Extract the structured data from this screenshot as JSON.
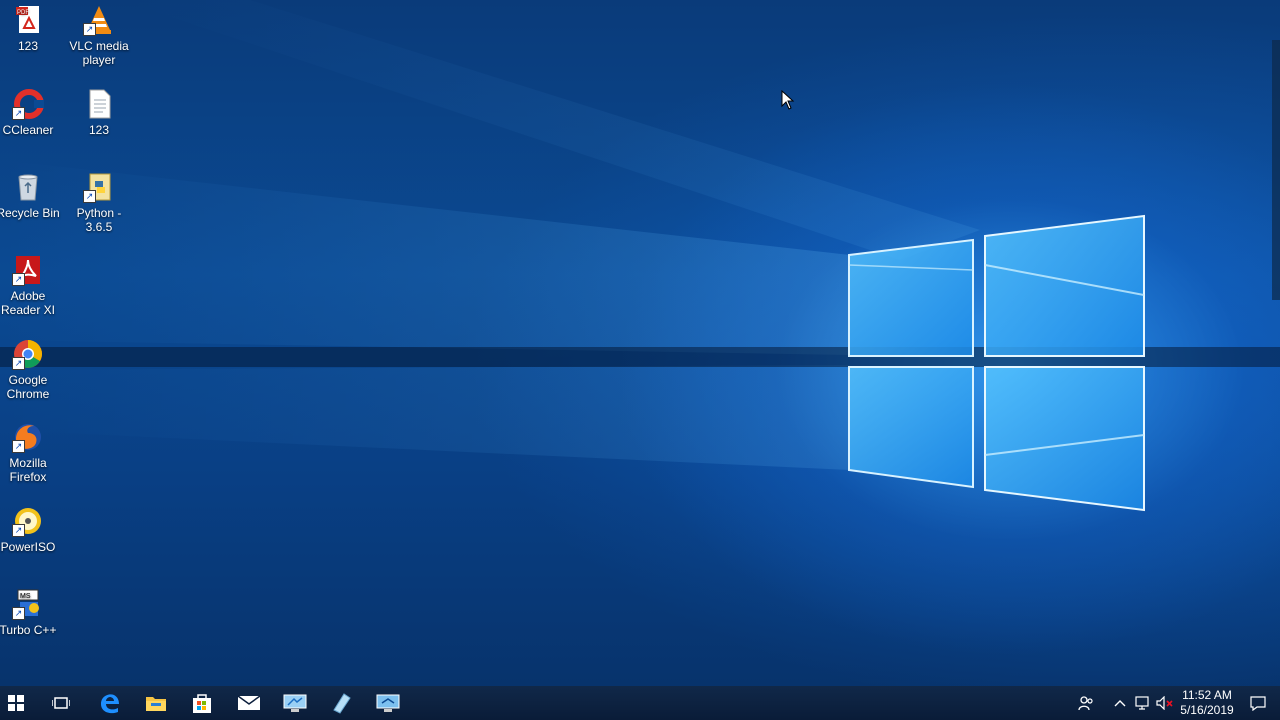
{
  "desktop": {
    "icons": [
      {
        "label": "123",
        "icon": "pdf-icon"
      },
      {
        "label": "VLC media player",
        "icon": "vlc-icon"
      },
      {
        "label": "CCleaner",
        "icon": "ccleaner-icon"
      },
      {
        "label": "123",
        "icon": "text-file-icon"
      },
      {
        "label": "Recycle Bin",
        "icon": "recycle-bin-icon"
      },
      {
        "label": "Python - 3.6.5",
        "icon": "python-installer-icon"
      },
      {
        "label": "Adobe Reader XI",
        "icon": "adobe-reader-icon"
      },
      {
        "label": "Google Chrome",
        "icon": "chrome-icon"
      },
      {
        "label": "Mozilla Firefox",
        "icon": "firefox-icon"
      },
      {
        "label": "PowerISO",
        "icon": "poweriso-icon"
      },
      {
        "label": "Turbo C++",
        "icon": "turbo-cpp-icon"
      }
    ]
  },
  "taskbar": {
    "pinned": [
      "start-icon",
      "task-view-icon",
      "edge-icon",
      "file-explorer-icon",
      "store-icon",
      "mail-icon",
      "remote-desktop-icon",
      "notepad-icon",
      "remote-connection-icon"
    ],
    "clock": {
      "time": "11:52 AM",
      "date": "5/16/2019"
    }
  },
  "colors": {
    "accent": "#1e90ff",
    "taskbar": "#0b1e3c"
  }
}
